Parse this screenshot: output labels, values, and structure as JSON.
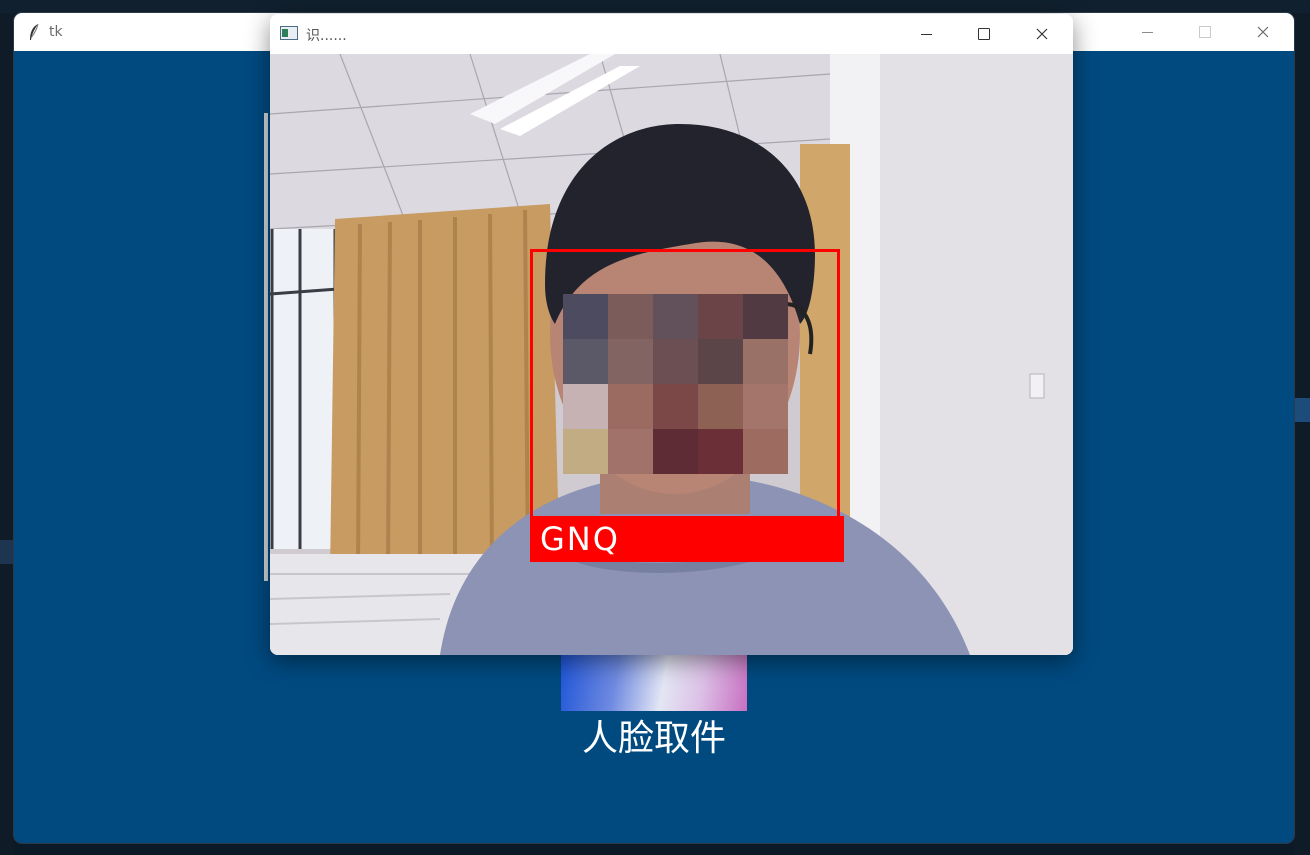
{
  "tk_window": {
    "title": "tk",
    "caption": "人脸取件",
    "controls": {
      "minimize": "—",
      "maximize": "☐",
      "close": "✕"
    }
  },
  "camera_window": {
    "title": "识......",
    "controls": {
      "minimize": "—",
      "maximize": "☐",
      "close": "✕"
    }
  },
  "detection": {
    "label": "GNQ",
    "box_color": "#ff0000"
  },
  "colors": {
    "window_bg": "#004a80",
    "accent_red": "#ff0000"
  },
  "mosaic_colors": [
    "#4d4b5f",
    "#7c5c5a",
    "#62505a",
    "#6b4448",
    "#523a42",
    "#5b5867",
    "#826462",
    "#6c4f52",
    "#5c4549",
    "#9a7166",
    "#c6b2b3",
    "#9b6b61",
    "#7b4747",
    "#8d6154",
    "#a4756a",
    "#c2ac84",
    "#a0726a",
    "#5e2c35",
    "#6b2f38",
    "#9d6b60"
  ]
}
